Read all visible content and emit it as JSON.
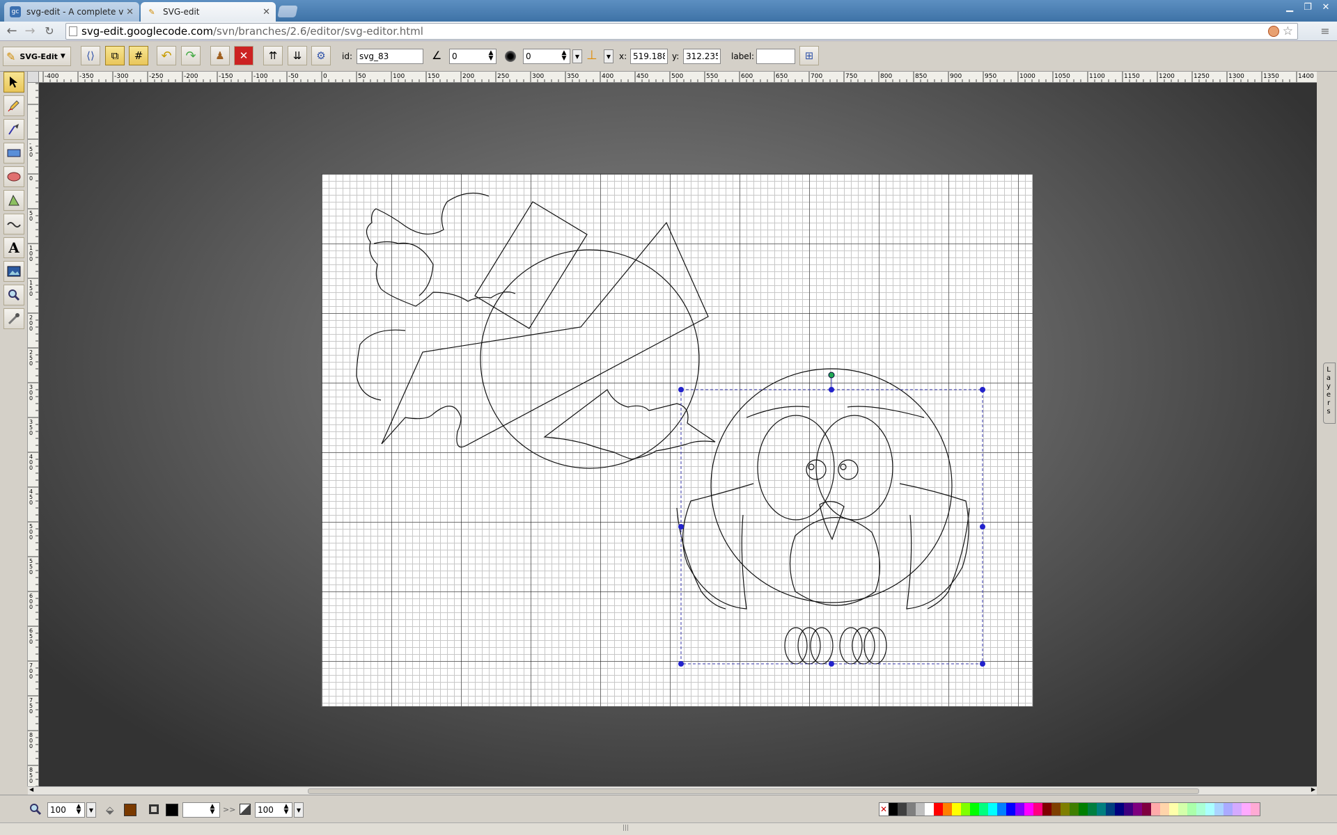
{
  "browser": {
    "tabs": [
      {
        "title": "svg-edit - A complete vec",
        "icon": "googlecode-icon",
        "active": false
      },
      {
        "title": "SVG-edit",
        "icon": "svg-edit-logo-icon",
        "active": true
      }
    ],
    "url_host": "svg-edit.googlecode.com",
    "url_path": "/svn/branches/2.6/editor/svg-editor.html"
  },
  "toolbar": {
    "app_menu_label": "SVG-Edit",
    "id_label": "id:",
    "id_value": "svg_83",
    "angle_value": "0",
    "blur_value": "0",
    "x_label": "x:",
    "x_value": "519.188",
    "y_label": "y:",
    "y_value": "312.235",
    "label_label": "label:",
    "label_value": ""
  },
  "rulers": {
    "horizontal_ticks": [
      "-400",
      "-350",
      "-300",
      "-250",
      "-200",
      "-150",
      "-100",
      "-50",
      "0",
      "50",
      "100",
      "150",
      "200",
      "250",
      "300",
      "350",
      "400",
      "450",
      "500",
      "550",
      "600",
      "650",
      "700",
      "750",
      "800",
      "850",
      "900",
      "950",
      "1000",
      "1050",
      "1100",
      "1150",
      "1200",
      "1250",
      "1300",
      "1350",
      "1400"
    ],
    "vertical_ticks": [
      "-50",
      "0",
      "50",
      "100",
      "150",
      "200",
      "250",
      "300",
      "350",
      "400",
      "450",
      "500",
      "550",
      "600",
      "650",
      "700",
      "750",
      "800",
      "850"
    ]
  },
  "layers_label": "Layers",
  "bottom": {
    "zoom_value": "100",
    "fill_color": "#7a3a00",
    "stroke_color": "#000000",
    "stroke_width": "",
    "opacity_value": "100",
    "more_label": ">>"
  },
  "palette": [
    "none",
    "#000000",
    "#3f3f3f",
    "#7f7f7f",
    "#bfbfbf",
    "#ffffff",
    "#ff0000",
    "#ff7f00",
    "#ffff00",
    "#7fff00",
    "#00ff00",
    "#00ff7f",
    "#00ffff",
    "#007fff",
    "#0000ff",
    "#7f00ff",
    "#ff00ff",
    "#ff007f",
    "#7f0000",
    "#7f3f00",
    "#7f7f00",
    "#3f7f00",
    "#007f00",
    "#007f3f",
    "#007f7f",
    "#003f7f",
    "#00007f",
    "#3f007f",
    "#7f007f",
    "#7f003f",
    "#ffaaaa",
    "#ffd4aa",
    "#ffffaa",
    "#d4ffaa",
    "#aaffaa",
    "#aaffd4",
    "#aaffff",
    "#aad4ff",
    "#aaaaff",
    "#d4aaff",
    "#ffaaff",
    "#ffaad4"
  ]
}
